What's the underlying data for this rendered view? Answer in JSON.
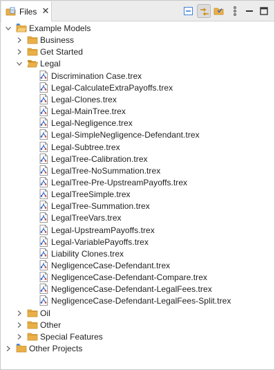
{
  "panel": {
    "tab_label": "Files",
    "tab_close": "✕",
    "toolbar": [
      {
        "name": "collapse-all-icon",
        "pressed": false
      },
      {
        "name": "link-with-editor-icon",
        "pressed": true
      },
      {
        "name": "filter-icon",
        "pressed": false
      },
      {
        "name": "view-menu-icon",
        "pressed": false
      },
      {
        "name": "minimize-icon",
        "pressed": false
      },
      {
        "name": "maximize-icon",
        "pressed": false
      }
    ]
  },
  "tree": [
    {
      "kind": "project",
      "label": "Example Models",
      "depth": 0,
      "expanded": true
    },
    {
      "kind": "folder",
      "label": "Business",
      "depth": 1,
      "expanded": false
    },
    {
      "kind": "folder",
      "label": "Get Started",
      "depth": 1,
      "expanded": false
    },
    {
      "kind": "folder",
      "label": "Legal",
      "depth": 1,
      "expanded": true
    },
    {
      "kind": "file",
      "label": "Discrimination Case.trex",
      "depth": 2
    },
    {
      "kind": "file",
      "label": "Legal-CalculateExtraPayoffs.trex",
      "depth": 2
    },
    {
      "kind": "file",
      "label": "Legal-Clones.trex",
      "depth": 2
    },
    {
      "kind": "file",
      "label": "Legal-MainTree.trex",
      "depth": 2
    },
    {
      "kind": "file",
      "label": "Legal-Negligence.trex",
      "depth": 2
    },
    {
      "kind": "file",
      "label": "Legal-SimpleNegligence-Defendant.trex",
      "depth": 2
    },
    {
      "kind": "file",
      "label": "Legal-Subtree.trex",
      "depth": 2
    },
    {
      "kind": "file",
      "label": "LegalTree-Calibration.trex",
      "depth": 2
    },
    {
      "kind": "file",
      "label": "LegalTree-NoSummation.trex",
      "depth": 2
    },
    {
      "kind": "file",
      "label": "LegalTree-Pre-UpstreamPayoffs.trex",
      "depth": 2
    },
    {
      "kind": "file",
      "label": "LegalTreeSimple.trex",
      "depth": 2
    },
    {
      "kind": "file",
      "label": "LegalTree-Summation.trex",
      "depth": 2
    },
    {
      "kind": "file",
      "label": "LegalTreeVars.trex",
      "depth": 2
    },
    {
      "kind": "file",
      "label": "Legal-UpstreamPayoffs.trex",
      "depth": 2
    },
    {
      "kind": "file",
      "label": "Legal-VariablePayoffs.trex",
      "depth": 2
    },
    {
      "kind": "file",
      "label": "Liability Clones.trex",
      "depth": 2
    },
    {
      "kind": "file",
      "label": "NegligenceCase-Defendant.trex",
      "depth": 2
    },
    {
      "kind": "file",
      "label": "NegligenceCase-Defendant-Compare.trex",
      "depth": 2
    },
    {
      "kind": "file",
      "label": "NegligenceCase-Defendant-LegalFees.trex",
      "depth": 2
    },
    {
      "kind": "file",
      "label": "NegligenceCase-Defendant-LegalFees-Split.trex",
      "depth": 2
    },
    {
      "kind": "folder",
      "label": "Oil",
      "depth": 1,
      "expanded": false
    },
    {
      "kind": "folder",
      "label": "Other",
      "depth": 1,
      "expanded": false
    },
    {
      "kind": "folder",
      "label": "Special Features",
      "depth": 1,
      "expanded": false
    },
    {
      "kind": "project",
      "label": "Other Projects",
      "depth": 0,
      "expanded": false
    }
  ],
  "colors": {
    "folder": "#e9b04a",
    "folder_dark": "#c98b1f",
    "project_accent": "#3c7fd8",
    "file_accent": "#2f5fbf",
    "twistie": "#6a6a6a"
  }
}
